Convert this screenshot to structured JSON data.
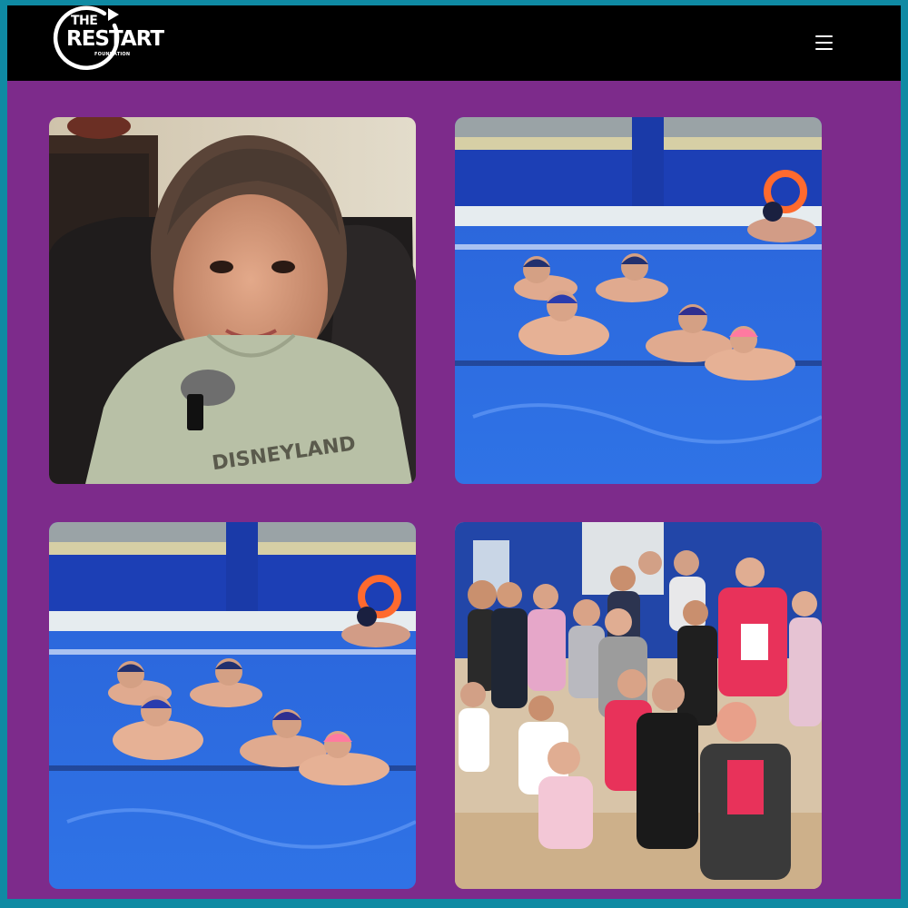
{
  "header": {
    "logo": {
      "line1": "THE",
      "line2": "RESTART",
      "line3": "FOUNDATION"
    },
    "menu_icon": "hamburger-menu-icon"
  },
  "gallery": {
    "items": [
      {
        "subject": "girl-portrait-photo"
      },
      {
        "subject": "kids-swimming-pool-photo"
      },
      {
        "subject": "kids-swimming-pool-photo"
      },
      {
        "subject": "kids-group-photo"
      }
    ]
  },
  "colors": {
    "page_border": "#0f8aa3",
    "page_background": "#7d2b8b",
    "header_background": "#000000"
  }
}
